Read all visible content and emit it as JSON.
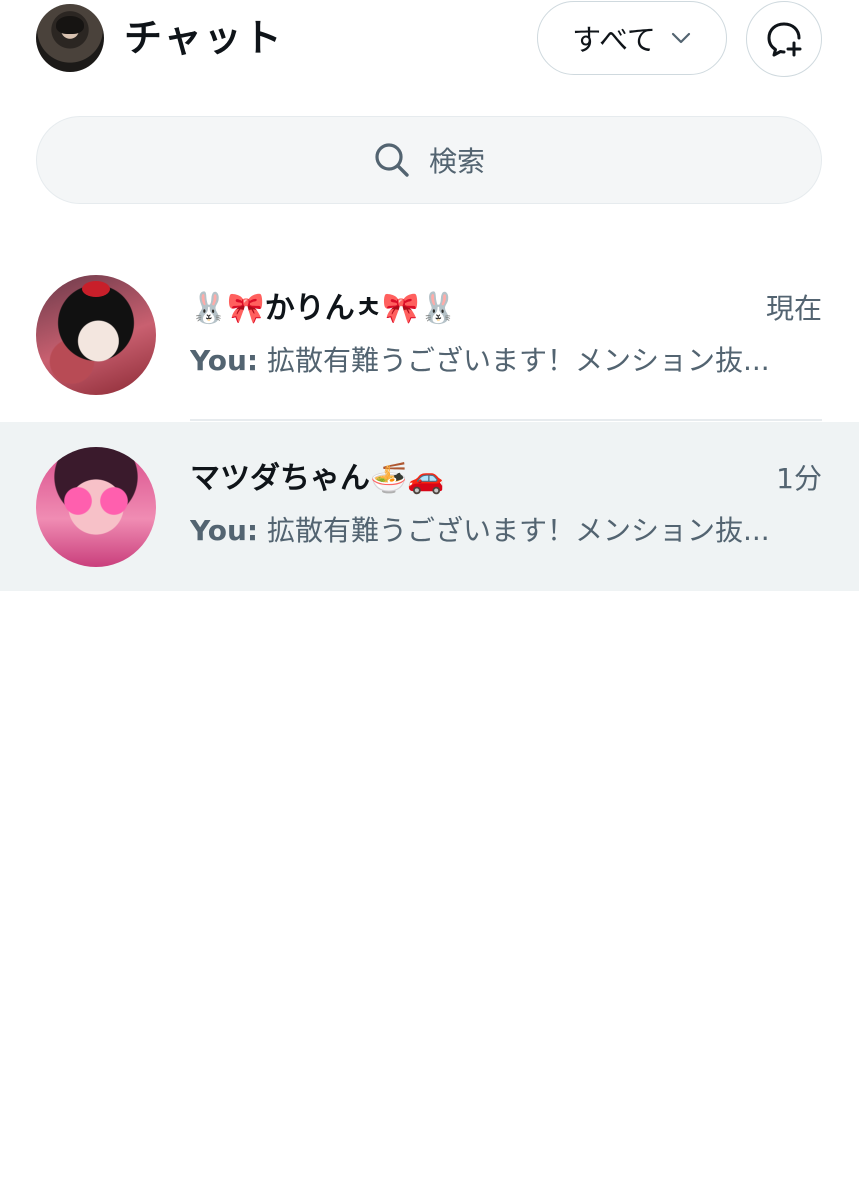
{
  "header": {
    "title": "チャット",
    "filter_label": "すべて",
    "filter_icon": "chevron-down-icon",
    "compose_icon": "new-chat-icon",
    "avatar_icon": "user-avatar"
  },
  "search": {
    "placeholder": "検索",
    "icon": "search-icon"
  },
  "conversations": [
    {
      "name": "🐰🎀かりんㅊ🎀🐰",
      "time": "現在",
      "preview_prefix": "You:",
      "preview": "拡散有難うございます！メンション抜...",
      "selected": false
    },
    {
      "name": "マツダちゃん🍜🚗",
      "time": "1分",
      "preview_prefix": "You:",
      "preview": "拡散有難うございます！メンション抜...",
      "selected": true
    }
  ],
  "colors": {
    "text_primary": "#0f1419",
    "text_secondary": "#536471",
    "border": "#cfd9de",
    "search_bg": "#f4f6f7",
    "selected_row_bg": "#eff3f4"
  }
}
